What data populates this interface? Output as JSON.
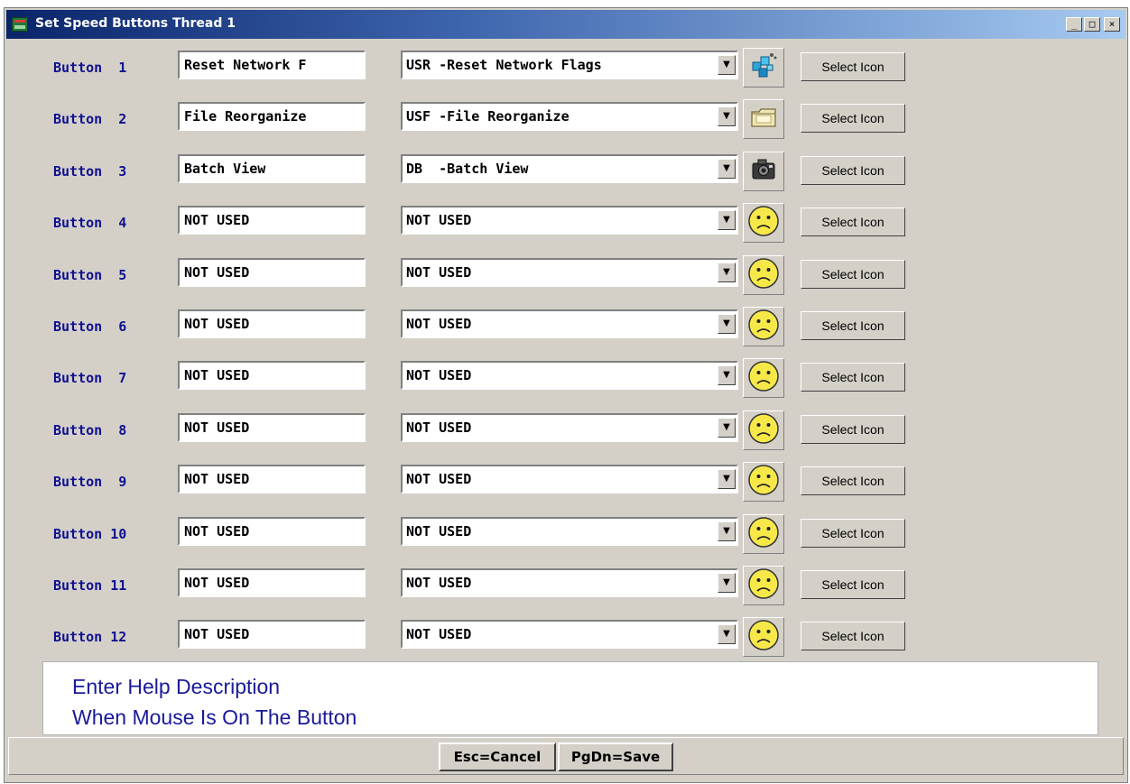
{
  "window": {
    "title": "Set Speed Buttons Thread 1",
    "controls": {
      "minimize": "_",
      "maximize": "□",
      "close": "×"
    }
  },
  "dropdown_arrow": "▼",
  "select_icon_label": "Select Icon",
  "rows": [
    {
      "label": "Button  1",
      "name": "Reset Network F",
      "function": "USR -Reset Network Flags",
      "icon": "network-icon"
    },
    {
      "label": "Button  2",
      "name": "File Reorganize",
      "function": "USF -File Reorganize",
      "icon": "folder-icon"
    },
    {
      "label": "Button  3",
      "name": "Batch View",
      "function": "DB  -Batch View",
      "icon": "camera-icon"
    },
    {
      "label": "Button  4",
      "name": "NOT USED",
      "function": "NOT USED",
      "icon": "sad-face-icon"
    },
    {
      "label": "Button  5",
      "name": "NOT USED",
      "function": "NOT USED",
      "icon": "sad-face-icon"
    },
    {
      "label": "Button  6",
      "name": "NOT USED",
      "function": "NOT USED",
      "icon": "sad-face-icon"
    },
    {
      "label": "Button  7",
      "name": "NOT USED",
      "function": "NOT USED",
      "icon": "sad-face-icon"
    },
    {
      "label": "Button  8",
      "name": "NOT USED",
      "function": "NOT USED",
      "icon": "sad-face-icon"
    },
    {
      "label": "Button  9",
      "name": "NOT USED",
      "function": "NOT USED",
      "icon": "sad-face-icon"
    },
    {
      "label": "Button 10",
      "name": "NOT USED",
      "function": "NOT USED",
      "icon": "sad-face-icon"
    },
    {
      "label": "Button 11",
      "name": "NOT USED",
      "function": "NOT USED",
      "icon": "sad-face-icon"
    },
    {
      "label": "Button 12",
      "name": "NOT USED",
      "function": "NOT USED",
      "icon": "sad-face-icon"
    }
  ],
  "help": {
    "line1": "Enter Help Description",
    "line2": "When Mouse Is On The Button"
  },
  "footer": {
    "cancel": "Esc=Cancel",
    "save": "PgDn=Save"
  }
}
